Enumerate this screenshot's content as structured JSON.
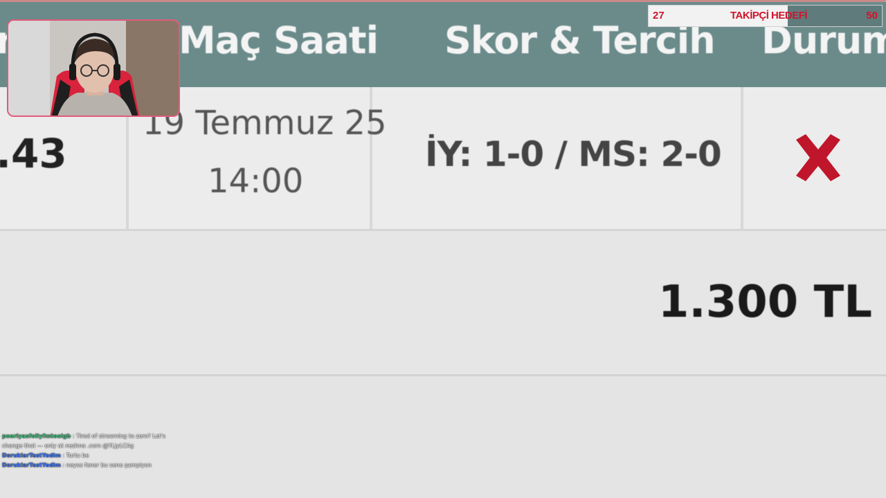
{
  "table": {
    "header": {
      "left_fragment": "r",
      "match_time": "Maç Saati",
      "score_pick": "Skor & Tercih",
      "status": "Durum"
    },
    "row": {
      "odds": ".43",
      "date": "19 Temmuz 25",
      "time": "14:00",
      "score": "İY: 1-0 / MS: 2-0",
      "status_icon": "cross-icon",
      "status_color": "#c0162b"
    },
    "total": "1.300 TL"
  },
  "follower_goal": {
    "current": "27",
    "label": "TAKİPÇİ HEDEFİ",
    "target": "50",
    "progress": 0.54,
    "text_color": "#d0142c"
  },
  "chat": [
    {
      "user": "poorlyasfollyfmtoolgb",
      "user_color": "#3fbf7f",
      "message": ": Tired of streaming to zero? Let's change that — only at nezhna .com @YLjyLCAg"
    },
    {
      "user": "DoruklarTestYedim",
      "user_color": "#3b78ff",
      "message": ": Turtu be"
    },
    {
      "user": "DoruklarTestYedim",
      "user_color": "#3b78ff",
      "message": ": neyse fener bu sene şampiyon"
    }
  ]
}
